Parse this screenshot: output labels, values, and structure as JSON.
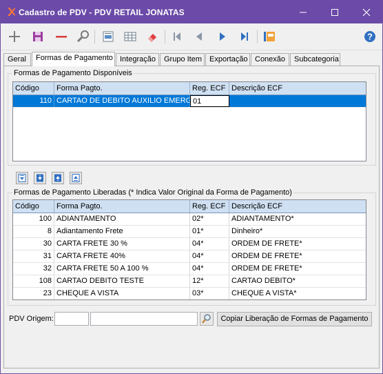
{
  "window": {
    "title": "Cadastro de PDV - PDV RETAIL JONATAS"
  },
  "tabs": [
    {
      "label": "Geral"
    },
    {
      "label": "Formas de Pagamento"
    },
    {
      "label": "Integração"
    },
    {
      "label": "Grupo Item"
    },
    {
      "label": "Exportação"
    },
    {
      "label": "Conexão"
    },
    {
      "label": "Subcategoria"
    }
  ],
  "active_tab": "Formas de Pagamento",
  "available": {
    "group_label": "Formas de Pagamento Disponíveis",
    "columns": [
      "Código",
      "Forma Pagto.",
      "Reg. ECF",
      "Descrição ECF"
    ],
    "rows": [
      {
        "codigo": "110",
        "forma": "CARTAO DE DEBITO AUXILIO EMERGEN",
        "reg": "01",
        "desc": ""
      }
    ]
  },
  "released": {
    "group_label": "Formas de Pagamento Liberadas (* Indica Valor Original da Forma de Pagamento)",
    "columns": [
      "Código",
      "Forma Pagto.",
      "Reg. ECF",
      "Descrição ECF"
    ],
    "rows": [
      {
        "codigo": "100",
        "forma": "ADIANTAMENTO",
        "reg": "02*",
        "desc": "ADIANTAMENTO*"
      },
      {
        "codigo": "8",
        "forma": "Adiantamento Frete",
        "reg": "01*",
        "desc": "Dinheiro*"
      },
      {
        "codigo": "30",
        "forma": "CARTA FRETE 30 %",
        "reg": "04*",
        "desc": "ORDEM DE FRETE*"
      },
      {
        "codigo": "31",
        "forma": "CARTA FRETE 40%",
        "reg": "04*",
        "desc": "ORDEM DE FRETE*"
      },
      {
        "codigo": "32",
        "forma": "CARTA FRETE 50 A 100 %",
        "reg": "04*",
        "desc": "ORDEM DE FRETE*"
      },
      {
        "codigo": "108",
        "forma": "CARTAO DEBITO TESTE",
        "reg": "12*",
        "desc": "CARTAO DEBITO*"
      },
      {
        "codigo": "23",
        "forma": "CHEQUE A VISTA",
        "reg": "03*",
        "desc": "CHEQUE A VISTA*"
      }
    ]
  },
  "bottom": {
    "pdv_origem_label": "PDV Origem:",
    "pdv_origem_code": "",
    "pdv_origem_name": "",
    "copy_button": "Copiar Liberação de Formas de Pagamento"
  },
  "colors": {
    "titlebar": "#6b4aa8",
    "selection": "#0078d7",
    "grid_header": "#cfe0f2"
  },
  "icons": [
    "app-icon",
    "add-icon",
    "save-icon",
    "remove-icon",
    "search-icon",
    "report-icon",
    "grid-icon",
    "eraser-icon",
    "first-icon",
    "prev-icon",
    "next-icon",
    "last-icon",
    "export-icon",
    "help-icon",
    "move-down-icon",
    "move-all-down-icon",
    "move-up-icon",
    "move-all-up-icon"
  ]
}
